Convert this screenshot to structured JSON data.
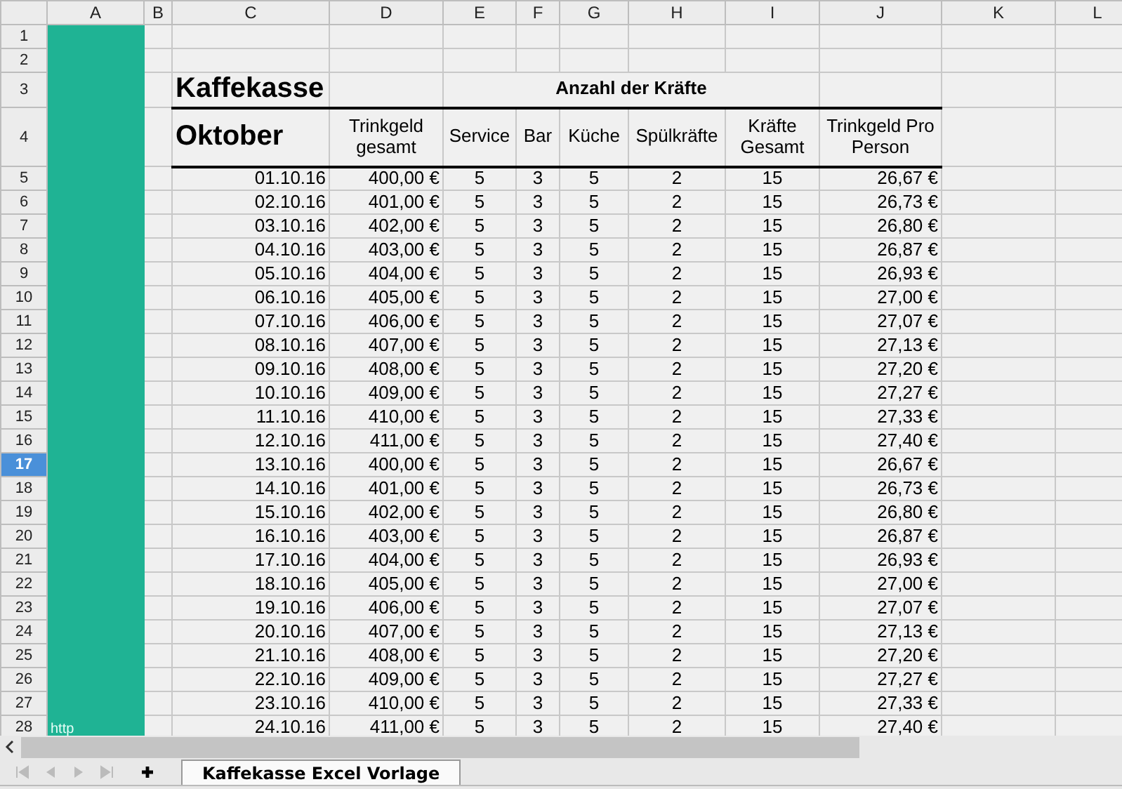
{
  "column_headers": [
    "A",
    "B",
    "C",
    "D",
    "E",
    "F",
    "G",
    "H",
    "I",
    "J",
    "K",
    "L"
  ],
  "row_headers": [
    {
      "label": "1",
      "selected": false
    },
    {
      "label": "2",
      "selected": false
    },
    {
      "label": "3",
      "selected": false
    },
    {
      "label": "4",
      "selected": false
    },
    {
      "label": "5",
      "selected": false
    },
    {
      "label": "6",
      "selected": false
    },
    {
      "label": "7",
      "selected": false
    },
    {
      "label": "8",
      "selected": false
    },
    {
      "label": "9",
      "selected": false
    },
    {
      "label": "10",
      "selected": false
    },
    {
      "label": "11",
      "selected": false
    },
    {
      "label": "12",
      "selected": false
    },
    {
      "label": "13",
      "selected": false
    },
    {
      "label": "14",
      "selected": false
    },
    {
      "label": "15",
      "selected": false
    },
    {
      "label": "16",
      "selected": false
    },
    {
      "label": "17",
      "selected": true
    },
    {
      "label": "18",
      "selected": false
    },
    {
      "label": "19",
      "selected": false
    },
    {
      "label": "20",
      "selected": false
    },
    {
      "label": "21",
      "selected": false
    },
    {
      "label": "22",
      "selected": false
    },
    {
      "label": "23",
      "selected": false
    },
    {
      "label": "24",
      "selected": false
    },
    {
      "label": "25",
      "selected": false
    },
    {
      "label": "26",
      "selected": false
    },
    {
      "label": "27",
      "selected": false
    },
    {
      "label": "28",
      "selected": false
    }
  ],
  "title": "Kaffekasse",
  "month": "Oktober",
  "group_header": "Anzahl der Kräfte",
  "columns": [
    "Trinkgeld gesamt",
    "Service",
    "Bar",
    "Küche",
    "Spülkräfte",
    "Kräfte Gesamt",
    "Trinkgeld Pro Person"
  ],
  "rows": [
    [
      "01.10.16",
      "400,00 €",
      "5",
      "3",
      "5",
      "2",
      "15",
      "26,67 €"
    ],
    [
      "02.10.16",
      "401,00 €",
      "5",
      "3",
      "5",
      "2",
      "15",
      "26,73 €"
    ],
    [
      "03.10.16",
      "402,00 €",
      "5",
      "3",
      "5",
      "2",
      "15",
      "26,80 €"
    ],
    [
      "04.10.16",
      "403,00 €",
      "5",
      "3",
      "5",
      "2",
      "15",
      "26,87 €"
    ],
    [
      "05.10.16",
      "404,00 €",
      "5",
      "3",
      "5",
      "2",
      "15",
      "26,93 €"
    ],
    [
      "06.10.16",
      "405,00 €",
      "5",
      "3",
      "5",
      "2",
      "15",
      "27,00 €"
    ],
    [
      "07.10.16",
      "406,00 €",
      "5",
      "3",
      "5",
      "2",
      "15",
      "27,07 €"
    ],
    [
      "08.10.16",
      "407,00 €",
      "5",
      "3",
      "5",
      "2",
      "15",
      "27,13 €"
    ],
    [
      "09.10.16",
      "408,00 €",
      "5",
      "3",
      "5",
      "2",
      "15",
      "27,20 €"
    ],
    [
      "10.10.16",
      "409,00 €",
      "5",
      "3",
      "5",
      "2",
      "15",
      "27,27 €"
    ],
    [
      "11.10.16",
      "410,00 €",
      "5",
      "3",
      "5",
      "2",
      "15",
      "27,33 €"
    ],
    [
      "12.10.16",
      "411,00 €",
      "5",
      "3",
      "5",
      "2",
      "15",
      "27,40 €"
    ],
    [
      "13.10.16",
      "400,00 €",
      "5",
      "3",
      "5",
      "2",
      "15",
      "26,67 €"
    ],
    [
      "14.10.16",
      "401,00 €",
      "5",
      "3",
      "5",
      "2",
      "15",
      "26,73 €"
    ],
    [
      "15.10.16",
      "402,00 €",
      "5",
      "3",
      "5",
      "2",
      "15",
      "26,80 €"
    ],
    [
      "16.10.16",
      "403,00 €",
      "5",
      "3",
      "5",
      "2",
      "15",
      "26,87 €"
    ],
    [
      "17.10.16",
      "404,00 €",
      "5",
      "3",
      "5",
      "2",
      "15",
      "26,93 €"
    ],
    [
      "18.10.16",
      "405,00 €",
      "5",
      "3",
      "5",
      "2",
      "15",
      "27,00 €"
    ],
    [
      "19.10.16",
      "406,00 €",
      "5",
      "3",
      "5",
      "2",
      "15",
      "27,07 €"
    ],
    [
      "20.10.16",
      "407,00 €",
      "5",
      "3",
      "5",
      "2",
      "15",
      "27,13 €"
    ],
    [
      "21.10.16",
      "408,00 €",
      "5",
      "3",
      "5",
      "2",
      "15",
      "27,20 €"
    ],
    [
      "22.10.16",
      "409,00 €",
      "5",
      "3",
      "5",
      "2",
      "15",
      "27,27 €"
    ],
    [
      "23.10.16",
      "410,00 €",
      "5",
      "3",
      "5",
      "2",
      "15",
      "27,33 €"
    ],
    [
      "24.10.16",
      "411,00 €",
      "5",
      "3",
      "5",
      "2",
      "15",
      "27,40 €"
    ]
  ],
  "side_note": "http",
  "sheet_tabs": [
    {
      "label": "Kaffekasse Excel Vorlage",
      "selected": true
    }
  ]
}
